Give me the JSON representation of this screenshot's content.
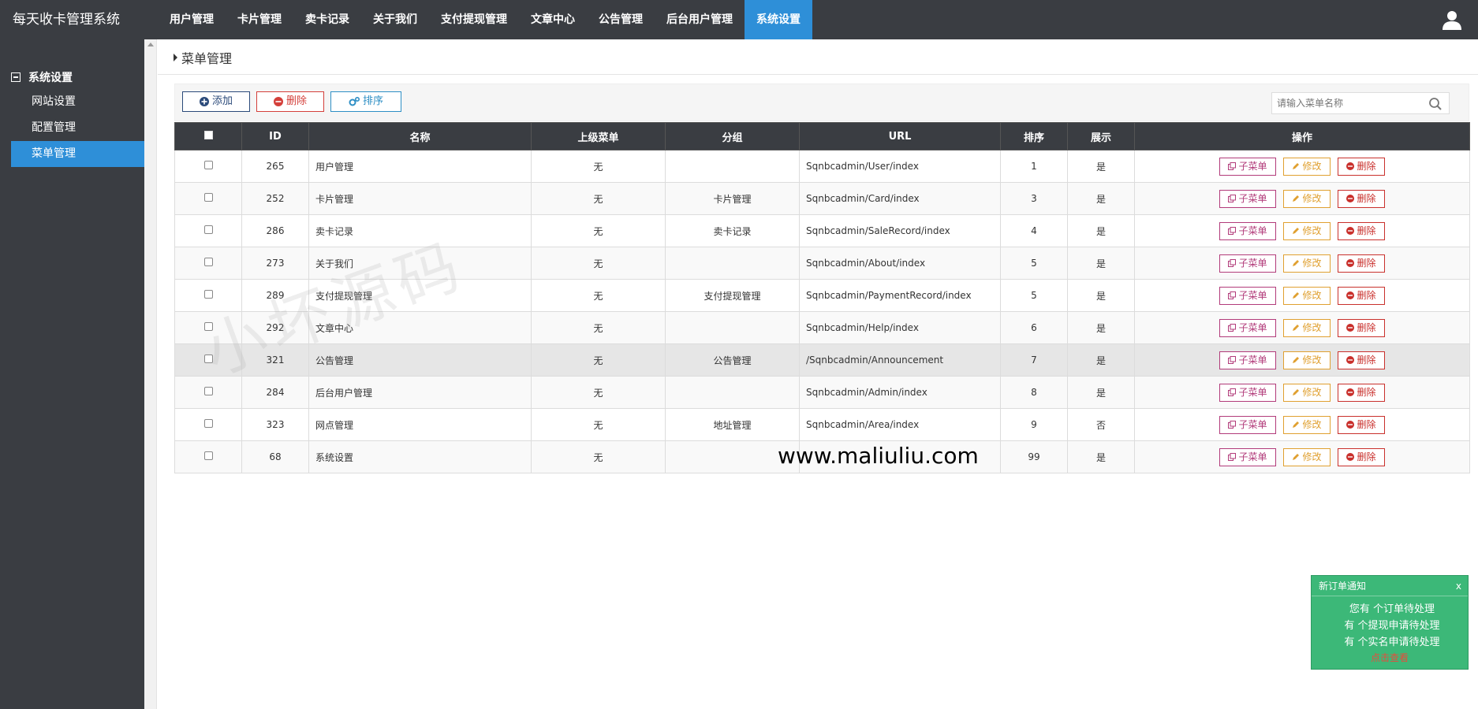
{
  "app": {
    "title": "每天收卡管理系统"
  },
  "topnav": [
    {
      "label": "用户管理"
    },
    {
      "label": "卡片管理"
    },
    {
      "label": "卖卡记录"
    },
    {
      "label": "关于我们"
    },
    {
      "label": "支付提现管理"
    },
    {
      "label": "文章中心"
    },
    {
      "label": "公告管理"
    },
    {
      "label": "后台用户管理"
    },
    {
      "label": "系统设置",
      "active": true
    }
  ],
  "sidebar": {
    "group": "系统设置",
    "items": [
      {
        "label": "网站设置"
      },
      {
        "label": "配置管理"
      },
      {
        "label": "菜单管理",
        "active": true
      }
    ]
  },
  "breadcrumb": {
    "title": "菜单管理"
  },
  "toolbar": {
    "add_label": "添加",
    "delete_label": "删除",
    "sort_label": "排序",
    "search_placeholder": "请输入菜单名称"
  },
  "table": {
    "headers": [
      "",
      "ID",
      "名称",
      "上级菜单",
      "分组",
      "URL",
      "排序",
      "展示",
      "操作"
    ],
    "rows": [
      {
        "id": "265",
        "name": "用户管理",
        "parent": "无",
        "group": "",
        "url": "Sqnbcadmin/User/index",
        "sort": "1",
        "show": "是"
      },
      {
        "id": "252",
        "name": "卡片管理",
        "parent": "无",
        "group": "卡片管理",
        "url": "Sqnbcadmin/Card/index",
        "sort": "3",
        "show": "是"
      },
      {
        "id": "286",
        "name": "卖卡记录",
        "parent": "无",
        "group": "卖卡记录",
        "url": "Sqnbcadmin/SaleRecord/index",
        "sort": "4",
        "show": "是"
      },
      {
        "id": "273",
        "name": "关于我们",
        "parent": "无",
        "group": "",
        "url": "Sqnbcadmin/About/index",
        "sort": "5",
        "show": "是"
      },
      {
        "id": "289",
        "name": "支付提现管理",
        "parent": "无",
        "group": "支付提现管理",
        "url": "Sqnbcadmin/PaymentRecord/index",
        "sort": "5",
        "show": "是"
      },
      {
        "id": "292",
        "name": "文章中心",
        "parent": "无",
        "group": "",
        "url": "Sqnbcadmin/Help/index",
        "sort": "6",
        "show": "是"
      },
      {
        "id": "321",
        "name": "公告管理",
        "parent": "无",
        "group": "公告管理",
        "url": "/Sqnbcadmin/Announcement",
        "sort": "7",
        "show": "是",
        "highlight": true
      },
      {
        "id": "284",
        "name": "后台用户管理",
        "parent": "无",
        "group": "",
        "url": "Sqnbcadmin/Admin/index",
        "sort": "8",
        "show": "是"
      },
      {
        "id": "323",
        "name": "网点管理",
        "parent": "无",
        "group": "地址管理",
        "url": "Sqnbcadmin/Area/index",
        "sort": "9",
        "show": "否"
      },
      {
        "id": "68",
        "name": "系统设置",
        "parent": "无",
        "group": "",
        "url": "",
        "sort": "99",
        "show": "是"
      }
    ],
    "actions": {
      "sub": "子菜单",
      "edit": "修改",
      "delete": "删除"
    }
  },
  "watermark": {
    "text": "小坏源码",
    "url": "www.maliuliu.com"
  },
  "notice": {
    "title": "新订单通知",
    "close": "x",
    "lines": [
      "您有 个订单待处理",
      "有 个提现申请待处理",
      "有 个实名申请待处理"
    ],
    "link": "点击查看"
  },
  "colors": {
    "topbar": "#3a3d42",
    "accent": "#2e8fd8",
    "notice": "#3cb878"
  }
}
